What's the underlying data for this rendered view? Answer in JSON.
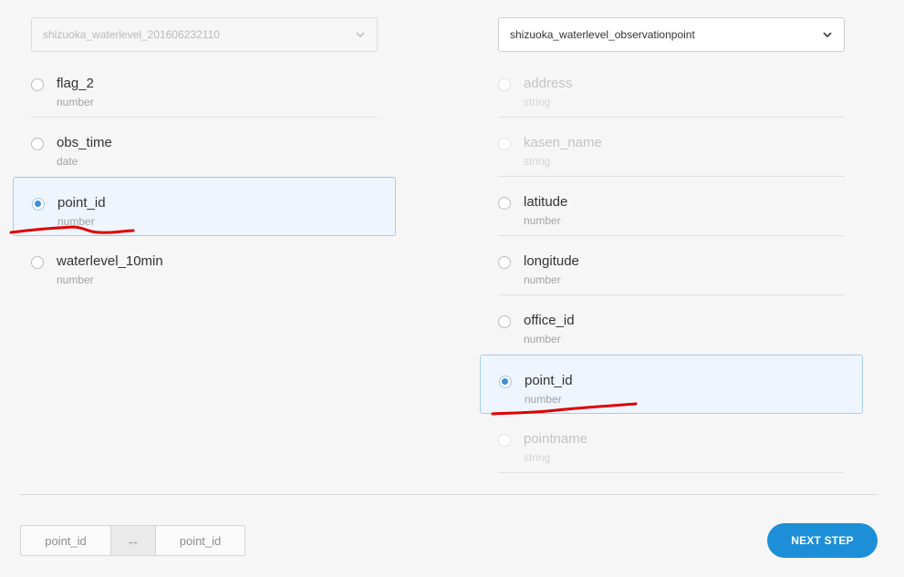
{
  "left_table": {
    "selected_table": "shizuoka_waterlevel_201606232110",
    "fields": [
      {
        "name": "flag_2",
        "type": "number"
      },
      {
        "name": "obs_time",
        "type": "date"
      },
      {
        "name": "point_id",
        "type": "number"
      },
      {
        "name": "waterlevel_10min",
        "type": "number"
      }
    ]
  },
  "right_table": {
    "selected_table": "shizuoka_waterlevel_observationpoint",
    "fields": [
      {
        "name": "address",
        "type": "string"
      },
      {
        "name": "kasen_name",
        "type": "string"
      },
      {
        "name": "latitude",
        "type": "number"
      },
      {
        "name": "longitude",
        "type": "number"
      },
      {
        "name": "office_id",
        "type": "number"
      },
      {
        "name": "point_id",
        "type": "number"
      },
      {
        "name": "pointname",
        "type": "string"
      }
    ]
  },
  "join": {
    "left_key": "point_id",
    "arrow": "↔",
    "right_key": "point_id"
  },
  "next_label": "NEXT STEP",
  "colors": {
    "accent": "#1d8fd8",
    "selected_bg": "#eef5fd",
    "annotation": "#e00000"
  }
}
